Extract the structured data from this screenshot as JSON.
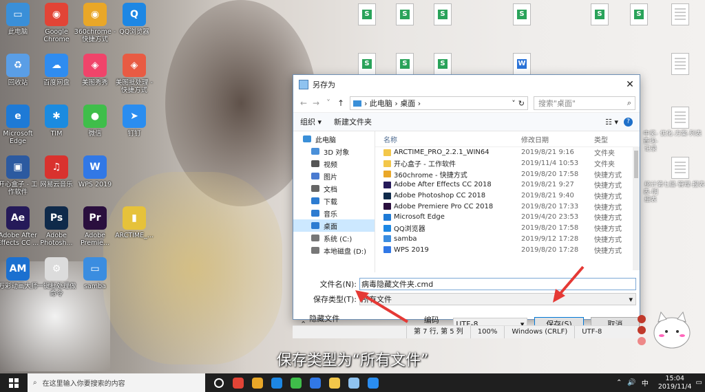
{
  "desktop": {
    "icons": [
      {
        "label": "此电脑",
        "color": "#3a8fd8",
        "glyph": "▭"
      },
      {
        "label": "Google Chrome",
        "color": "#e24436",
        "glyph": "◉"
      },
      {
        "label": "360chrome - 快捷方式",
        "color": "#e9a728",
        "glyph": "◉"
      },
      {
        "label": "QQ浏览器",
        "color": "#1d87e4",
        "glyph": "Q"
      },
      {
        "label": "回收站",
        "color": "#5a9ee6",
        "glyph": "♻"
      },
      {
        "label": "百度网盘",
        "color": "#2f8cf0",
        "glyph": "☁"
      },
      {
        "label": "美图秀秀",
        "color": "#f0446a",
        "glyph": "◈"
      },
      {
        "label": "美图批处理 - 快捷方式",
        "color": "#e85b43",
        "glyph": "◈"
      },
      {
        "label": "Microsoft Edge",
        "color": "#1e7ad6",
        "glyph": "e"
      },
      {
        "label": "TIM",
        "color": "#1b8be0",
        "glyph": "✱"
      },
      {
        "label": "微信",
        "color": "#3fbe4a",
        "glyph": "●"
      },
      {
        "label": "钉钉",
        "color": "#2a8df0",
        "glyph": "➤"
      },
      {
        "label": "开心盒子 - 工作软件",
        "color": "#2c5aa0",
        "glyph": "▣"
      },
      {
        "label": "网易云音乐",
        "color": "#d9322e",
        "glyph": "♫"
      },
      {
        "label": "WPS 2019",
        "color": "#3178e6",
        "glyph": "W"
      },
      {
        "label": "Adobe After Effects CC ...",
        "color": "#251a59",
        "glyph": "Ae"
      },
      {
        "label": "Adobe Photosh...",
        "color": "#0f2a4a",
        "glyph": "Ps"
      },
      {
        "label": "Adobe Premie...",
        "color": "#2a0f3e",
        "glyph": "Pr"
      },
      {
        "label": "ARCTIME_...",
        "color": "#e6c23a",
        "glyph": "▮"
      },
      {
        "label": "万彩动画大师",
        "color": "#1b70d0",
        "glyph": "AM"
      },
      {
        "label": "一键批处理做命令",
        "color": "#dcdcdc",
        "glyph": "⚙"
      },
      {
        "label": "samba",
        "color": "#3b8de0",
        "glyph": "▭"
      }
    ],
    "right_labels": [
      "中奖-查询-记录",
      "优化-方案-列表",
      "统计表-明细表",
      "第七届-管理-报表"
    ]
  },
  "dialog": {
    "title": "另存为",
    "path_root": "此电脑",
    "path_folder": "桌面",
    "search_placeholder": "搜索\"桌面\"",
    "toolbar": {
      "organize": "组织 ▾",
      "new_folder": "新建文件夹"
    },
    "nav": [
      {
        "label": "此电脑",
        "color": "#3a8fd8",
        "selected": false
      },
      {
        "label": "3D 对象",
        "color": "#4a90d9",
        "selected": false
      },
      {
        "label": "视频",
        "color": "#555555",
        "selected": false
      },
      {
        "label": "图片",
        "color": "#4a7bd0",
        "selected": false
      },
      {
        "label": "文档",
        "color": "#666666",
        "selected": false
      },
      {
        "label": "下载",
        "color": "#2d7cd1",
        "selected": false
      },
      {
        "label": "音乐",
        "color": "#2d7cd1",
        "selected": false
      },
      {
        "label": "桌面",
        "color": "#2d7cd1",
        "selected": true
      },
      {
        "label": "系统 (C:)",
        "color": "#777777",
        "selected": false
      },
      {
        "label": "本地磁盘 (D:)",
        "color": "#777777",
        "selected": false
      }
    ],
    "columns": {
      "name": "名称",
      "modified": "修改日期",
      "type": "类型"
    },
    "files": [
      {
        "name": "ARCTIME_PRO_2.2.1_WIN64",
        "date": "2019/8/21 9:16",
        "type": "文件夹",
        "color": "#f3c74a"
      },
      {
        "name": "开心盒子 - 工作软件",
        "date": "2019/11/4 10:53",
        "type": "文件夹",
        "color": "#f3c74a"
      },
      {
        "name": "360chrome - 快捷方式",
        "date": "2019/8/20 17:58",
        "type": "快捷方式",
        "color": "#e9a728"
      },
      {
        "name": "Adobe After Effects CC 2018",
        "date": "2019/8/21 9:27",
        "type": "快捷方式",
        "color": "#251a59"
      },
      {
        "name": "Adobe Photoshop CC 2018",
        "date": "2019/8/21 9:40",
        "type": "快捷方式",
        "color": "#0f2a4a"
      },
      {
        "name": "Adobe Premiere Pro CC 2018",
        "date": "2019/8/20 17:33",
        "type": "快捷方式",
        "color": "#2a0f3e"
      },
      {
        "name": "Microsoft Edge",
        "date": "2019/4/20 23:53",
        "type": "快捷方式",
        "color": "#1e7ad6"
      },
      {
        "name": "QQ浏览器",
        "date": "2019/8/20 17:58",
        "type": "快捷方式",
        "color": "#1d87e4"
      },
      {
        "name": "samba",
        "date": "2019/9/12 17:28",
        "type": "快捷方式",
        "color": "#3b8de0"
      },
      {
        "name": "WPS 2019",
        "date": "2019/8/20 17:28",
        "type": "快捷方式",
        "color": "#3178e6"
      }
    ],
    "filename_label": "文件名(N):",
    "filename_value": "病毒隐藏文件夹.cmd",
    "filetype_label": "保存类型(T):",
    "filetype_value": "所有文件",
    "hide_folders": "隐藏文件夹",
    "encoding_label": "编码(E):",
    "encoding_value": "UTF-8",
    "save_button": "保存(S)",
    "cancel_button": "取消"
  },
  "statusbar": {
    "position": "第 7 行, 第 5 列",
    "zoom": "100%",
    "eol": "Windows (CRLF)",
    "encoding": "UTF-8"
  },
  "subtitle": "保存类型为“所有文件”",
  "taskbar": {
    "search_placeholder": "在这里输入你要搜索的内容",
    "time": "15:04",
    "date": "2019/11/4",
    "ime": "中",
    "apps": [
      {
        "name": "task-view-icon",
        "color": "#ffffff"
      },
      {
        "name": "chrome-icon",
        "color": "#e24436"
      },
      {
        "name": "360chrome-icon",
        "color": "#e9a728"
      },
      {
        "name": "qq-browser-icon",
        "color": "#1d87e4"
      },
      {
        "name": "wechat-icon",
        "color": "#3fbe4a"
      },
      {
        "name": "wps-icon",
        "color": "#3178e6"
      },
      {
        "name": "file-explorer-icon",
        "color": "#f3c74a"
      },
      {
        "name": "notepad-icon",
        "color": "#8fc3f0"
      },
      {
        "name": "dingtalk-icon",
        "color": "#2a8df0"
      }
    ]
  }
}
